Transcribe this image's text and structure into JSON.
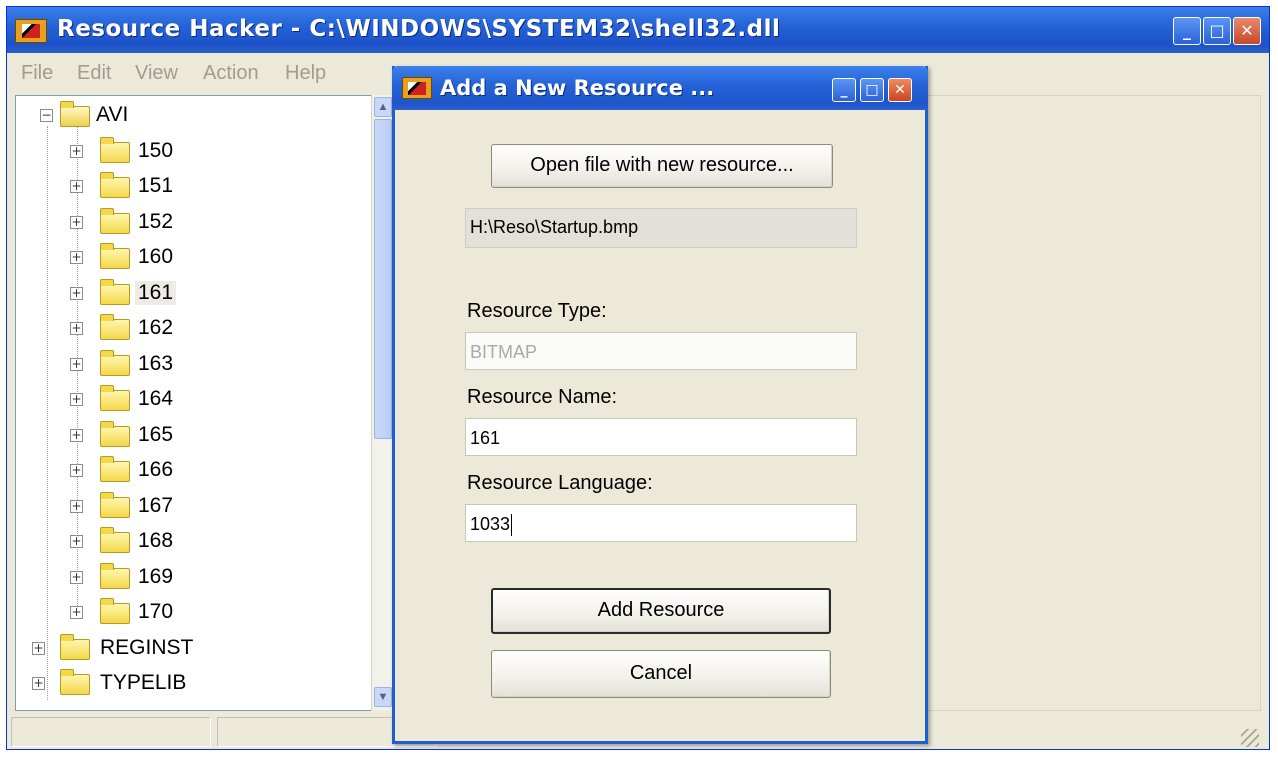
{
  "main_window": {
    "title": "Resource Hacker  -  C:\\WINDOWS\\SYSTEM32\\shell32.dll",
    "buttons": {
      "minimize": "_",
      "maximize": "□",
      "close": "✕"
    }
  },
  "menu": [
    "File",
    "Edit",
    "View",
    "Action",
    "Help"
  ],
  "tree": {
    "root": {
      "label": "AVI",
      "expanded": true
    },
    "children": [
      "150",
      "151",
      "152",
      "160",
      "161",
      "162",
      "163",
      "164",
      "165",
      "166",
      "167",
      "168",
      "169",
      "170"
    ],
    "selected": "161",
    "siblings": [
      "REGINST",
      "TYPELIB"
    ]
  },
  "dialog": {
    "title": "Add a New Resource ...",
    "buttons": {
      "minimize": "_",
      "maximize": "□",
      "close": "✕"
    },
    "open_file_button": "Open file with new resource...",
    "file_path": "H:\\Reso\\Startup.bmp",
    "resource_type_label": "Resource Type:",
    "resource_type_value": "BITMAP",
    "resource_name_label": "Resource Name:",
    "resource_name_value": "161",
    "resource_language_label": "Resource Language:",
    "resource_language_value": "1033",
    "add_button": "Add Resource",
    "cancel_button": "Cancel"
  },
  "colors": {
    "titlebar_blue": "#2563d8",
    "dialog_face": "#ece9d8",
    "folder_yellow": "#f3d84a"
  }
}
